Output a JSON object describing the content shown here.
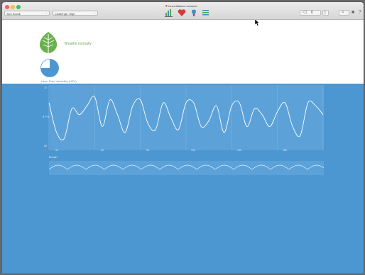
{
  "window": {
    "title": "Inner Balance.emwave"
  },
  "toolbar": {
    "user_select": "Tom Soock",
    "challenge_select": "Challenge: High",
    "icons": [
      "bar-chart-icon",
      "heart-icon",
      "lightbulb-icon",
      "menu-icon"
    ],
    "right_icons": [
      "audio-icon",
      "pause-icon",
      "settings-icon",
      "search-icon",
      "book-icon",
      "help-icon"
    ]
  },
  "coherence": {
    "status": "Breathe normally",
    "pie_fraction": 0.75,
    "accent": "#6ab04c"
  },
  "hrv": {
    "label": "Heart Rate Variability (HRV)",
    "ytitle": "B P M",
    "y_ticks": [
      "70",
      "60"
    ],
    "x_ticks": [
      "30",
      "60",
      "90",
      "120",
      "150",
      "180"
    ],
    "colors": {
      "background": "#4c97d2",
      "plot": "#5ca2d8",
      "line": "#ffffff"
    }
  },
  "breath": {
    "label": "Breath"
  },
  "chart_data": {
    "type": "line",
    "title": "Heart Rate Variability (HRV)",
    "xlabel": "",
    "ylabel": "B P M",
    "xlim": [
      0,
      180
    ],
    "ylim": [
      60,
      70
    ],
    "x_ticks": [
      30,
      60,
      90,
      120,
      150,
      180
    ],
    "grid": true,
    "series": [
      {
        "x": [
          0,
          5,
          10,
          15,
          20,
          25,
          30,
          35,
          40,
          45,
          50,
          55,
          60,
          65,
          70,
          75,
          80,
          85,
          90,
          95,
          100,
          105,
          110,
          115,
          120,
          125,
          130,
          135,
          140,
          145,
          150,
          155,
          160,
          165,
          170,
          175,
          180
        ],
        "values": [
          67.5,
          62.5,
          61.5,
          66.5,
          65.5,
          67.0,
          68.5,
          63.5,
          68.0,
          65.5,
          62.5,
          67.0,
          68.0,
          64.0,
          63.0,
          67.5,
          65.0,
          63.0,
          67.5,
          67.5,
          63.5,
          64.5,
          67.0,
          62.5,
          67.0,
          67.5,
          63.5,
          66.5,
          65.5,
          63.5,
          66.0,
          67.5,
          63.5,
          62.0,
          67.5,
          67.0,
          65.5
        ]
      }
    ]
  }
}
